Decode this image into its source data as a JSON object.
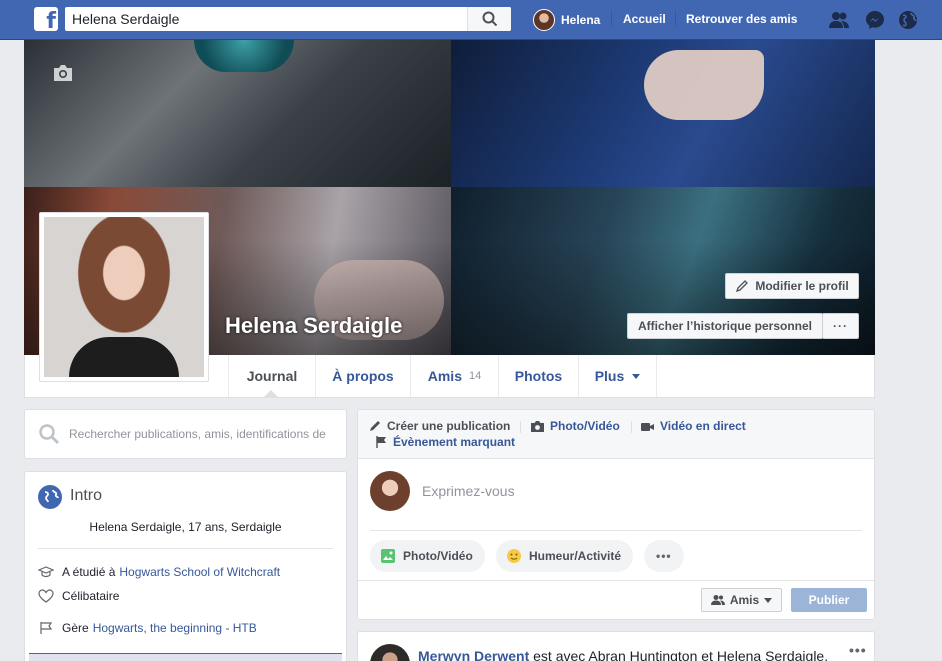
{
  "topbar": {
    "search_value": "Helena Serdaigle",
    "user_name": "Helena",
    "home": "Accueil",
    "find_friends": "Retrouver des amis",
    "brand_color": "#4267b2"
  },
  "cover": {
    "name": "Helena Serdaigle",
    "edit_profile": "Modifier le profil",
    "view_history": "Afficher l’historique personnel",
    "more": "···"
  },
  "tabs": {
    "journal": "Journal",
    "about": "À propos",
    "friends": "Amis",
    "friends_count": "14",
    "photos": "Photos",
    "more": "Plus"
  },
  "left": {
    "search_placeholder": "Rechercher publications, amis, identifications de",
    "intro_title": "Intro",
    "bio": "Helena Serdaigle, 17 ans, Serdaigle",
    "studied_prefix": "A étudié à",
    "studied_school": "Hogwarts School of Witchcraft",
    "relationship": "Célibataire",
    "manages_prefix": "Gère",
    "manages_page": "Hogwarts, the beginning - HTB"
  },
  "composer": {
    "create_post": "Créer une publication",
    "photo_video": "Photo/Vidéo",
    "live_video": "Vidéo en direct",
    "life_event": "Évènement marquant",
    "placeholder": "Exprimez-vous",
    "pill_photo": "Photo/Vidéo",
    "pill_mood": "Humeur/Activité",
    "pill_more": "•••",
    "audience": "Amis",
    "publish": "Publier"
  },
  "post": {
    "author": "Merwyn Derwent",
    "text": " est avec Abran Huntington et Helena Serdaigle.",
    "more": "•••"
  }
}
